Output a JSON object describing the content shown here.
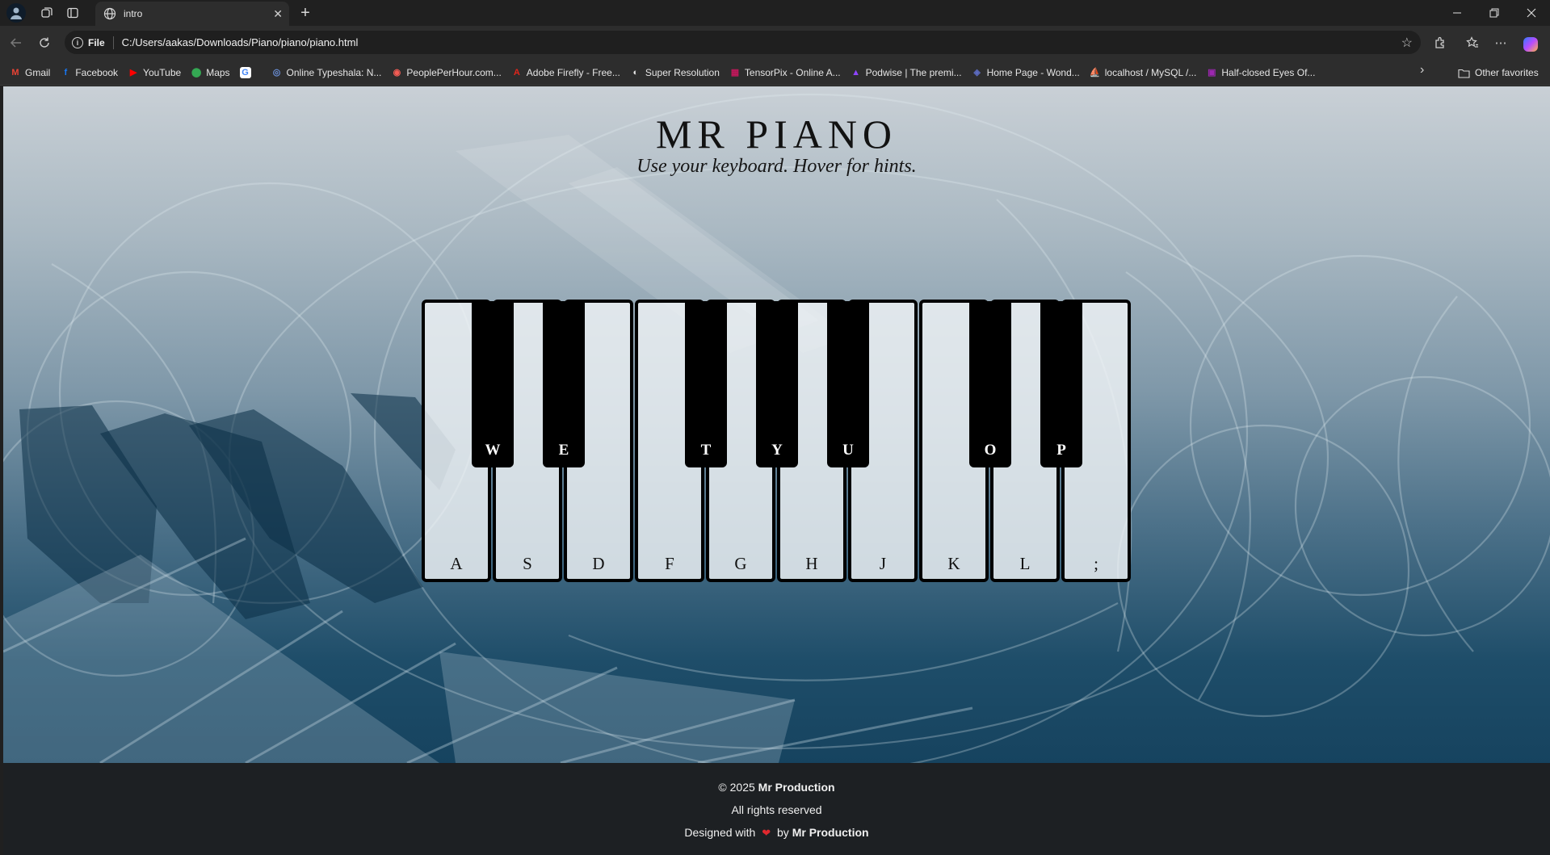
{
  "browser": {
    "tab_title": "intro",
    "url_scheme_label": "File",
    "url": "C:/Users/aakas/Downloads/Piano/piano/piano.html",
    "bookmarks": [
      {
        "label": "Gmail",
        "icon": "gmail-icon",
        "color": "#ea4335",
        "glyph": "M"
      },
      {
        "label": "Facebook",
        "icon": "facebook-icon",
        "color": "#1877f2",
        "glyph": "f"
      },
      {
        "label": "YouTube",
        "icon": "youtube-icon",
        "color": "#ff0000",
        "glyph": "▶"
      },
      {
        "label": "Maps",
        "icon": "maps-icon",
        "color": "#34a853",
        "glyph": "⬤"
      },
      {
        "label": "",
        "icon": "google-icon",
        "color": "#ffffff",
        "glyph": "G"
      },
      {
        "label": "Online Typeshala: N...",
        "icon": "typeshala-icon",
        "color": "#6a8fd8",
        "glyph": "◎"
      },
      {
        "label": "PeoplePerHour.com...",
        "icon": "peopleperhour-icon",
        "color": "#f25c54",
        "glyph": "◉"
      },
      {
        "label": "Adobe Firefly - Free...",
        "icon": "adobe-icon",
        "color": "#e1251b",
        "glyph": "A"
      },
      {
        "label": "Super Resolution",
        "icon": "super-resolution-icon",
        "color": "#e8e8e8",
        "glyph": "◐"
      },
      {
        "label": "TensorPix - Online A...",
        "icon": "tensorpix-icon",
        "color": "#c2185b",
        "glyph": "▦"
      },
      {
        "label": "Podwise | The premi...",
        "icon": "podwise-icon",
        "color": "#8e44ff",
        "glyph": "▲"
      },
      {
        "label": "Home Page - Wond...",
        "icon": "wonder-icon",
        "color": "#5c6bc0",
        "glyph": "◈"
      },
      {
        "label": "localhost / MySQL /...",
        "icon": "phpmyadmin-icon",
        "color": "#f39c12",
        "glyph": "⛵"
      },
      {
        "label": "Half-closed Eyes Of...",
        "icon": "image-site-icon",
        "color": "#9c27b0",
        "glyph": "▣"
      }
    ],
    "other_favorites": "Other favorites"
  },
  "page": {
    "title": "MR PIANO",
    "subtitle": "Use your keyboard. Hover for hints.",
    "white_keys": [
      "A",
      "S",
      "D",
      "F",
      "G",
      "H",
      "J",
      "K",
      "L",
      ";"
    ],
    "black_keys": [
      "W",
      "E",
      "T",
      "Y",
      "U",
      "O",
      "P"
    ],
    "footer": {
      "copyright_prefix": "© 2025",
      "brand": "Mr Production",
      "rights": "All rights reserved",
      "designed_with": "Designed with",
      "by": "by",
      "designer": "Mr Production"
    }
  }
}
